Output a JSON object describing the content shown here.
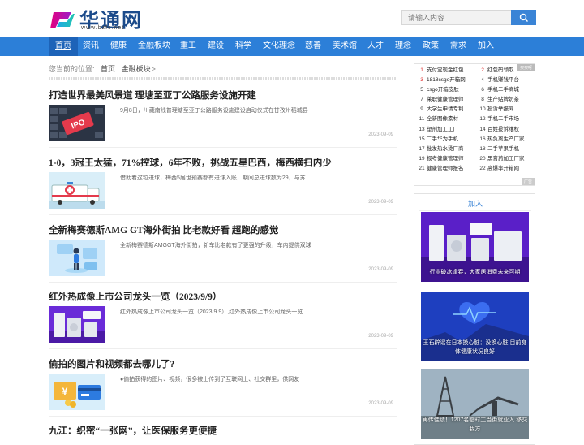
{
  "site": {
    "name": "华通网",
    "url": "www.bzfc.net"
  },
  "search": {
    "placeholder": "请输入内容"
  },
  "nav": [
    "首页",
    "资讯",
    "健康",
    "金融板块",
    "重工",
    "建设",
    "科学",
    "文化理念",
    "慈善",
    "美术馆",
    "人才",
    "理念",
    "政策",
    "需求",
    "加入"
  ],
  "breadcrumb": {
    "prefix": "您当前的位置:",
    "home": "首页",
    "current": "金融板块",
    "sep": ">"
  },
  "articles": [
    {
      "title": "打造世界最美风景道 理塘至亚丁公路服务设施开建",
      "desc": "9月8日，川藏南线普理塘至亚丁公路服务设施建设启动仪式在甘孜州稻城县",
      "date": "2023-09-09",
      "thumb": "ipo"
    },
    {
      "title": "1-0，3冠王太猛，71%控球，6年不败，挑战五星巴西，梅西横扫内少",
      "desc": "借助着这粒进球，梅西5届世预赛都有进球入账，期间总进球数为29，与苏",
      "date": "2023-09-09",
      "thumb": "ambulance"
    },
    {
      "title": "全新梅赛德斯AMG GT海外街拍 比老款好看 超跑的感觉",
      "desc": "全新梅赛德斯AMGGT海外街拍，新车比老款有了更强的升级，车内提供双球",
      "date": "2023-09-09",
      "thumb": "person"
    },
    {
      "title": "红外热成像上市公司龙头一览（2023/9/9）",
      "desc": "红外热成像上市公司龙头一览（2023 9 9）,红外热成像上市公司龙头一览",
      "date": "2023-09-09",
      "thumb": "appliances"
    },
    {
      "title": "偷拍的图片和视频都去哪儿了?",
      "desc": "●偷拍获得的图片、视频，很多被上传到了互联网上、社交群里，供网友",
      "date": "2023-09-09",
      "thumb": "money"
    },
    {
      "title": "九江：织密“一张网”，让医保服务更便捷",
      "desc": "",
      "date": "",
      "thumb": ""
    }
  ],
  "rank": {
    "tag": "买买呀",
    "tag2": "广告",
    "left": [
      {
        "n": "1",
        "t": "支付宝现金红包"
      },
      {
        "n": "3",
        "t": "1818csgo开箱网"
      },
      {
        "n": "5",
        "t": "csgo开箱皮肤"
      },
      {
        "n": "7",
        "t": "莱职健康管理师"
      },
      {
        "n": "9",
        "t": "大学生申请专利"
      },
      {
        "n": "11",
        "t": "全新图像素材"
      },
      {
        "n": "13",
        "t": "塑剂加工工厂"
      },
      {
        "n": "15",
        "t": "二手华为手机"
      },
      {
        "n": "17",
        "t": "批发热水烫厂商"
      },
      {
        "n": "19",
        "t": "报考健康管理师"
      },
      {
        "n": "21",
        "t": "健康管理师报名"
      }
    ],
    "right": [
      {
        "n": "2",
        "t": "红包码领取"
      },
      {
        "n": "4",
        "t": "手机赚钱平台"
      },
      {
        "n": "6",
        "t": "手机二手商城"
      },
      {
        "n": "8",
        "t": "生产贴牌奶茶"
      },
      {
        "n": "10",
        "t": "投诉举报网"
      },
      {
        "n": "12",
        "t": "手机二手市场"
      },
      {
        "n": "14",
        "t": "百姓投诉维权"
      },
      {
        "n": "16",
        "t": "热负离生产厂家"
      },
      {
        "n": "18",
        "t": "二手苹果手机"
      },
      {
        "n": "20",
        "t": "黑膏药加工厂家"
      },
      {
        "n": "22",
        "t": "高爆率开箱网"
      }
    ]
  },
  "ads": {
    "title": "加入",
    "cards": [
      {
        "caption": "行业破冰逢春，大家居消费未来可期"
      },
      {
        "caption": "王石辟谣在日本换心脏：没换心脏 目前身体健康状况良好"
      },
      {
        "caption": "再传佳绩！1207名临时工当街就业入 移交我方"
      }
    ]
  },
  "colors": {
    "nav": "#2c7fd8",
    "nav_active": "#1d63b8",
    "brand": "#1b4a8a",
    "search_button": "#3a84d6"
  }
}
